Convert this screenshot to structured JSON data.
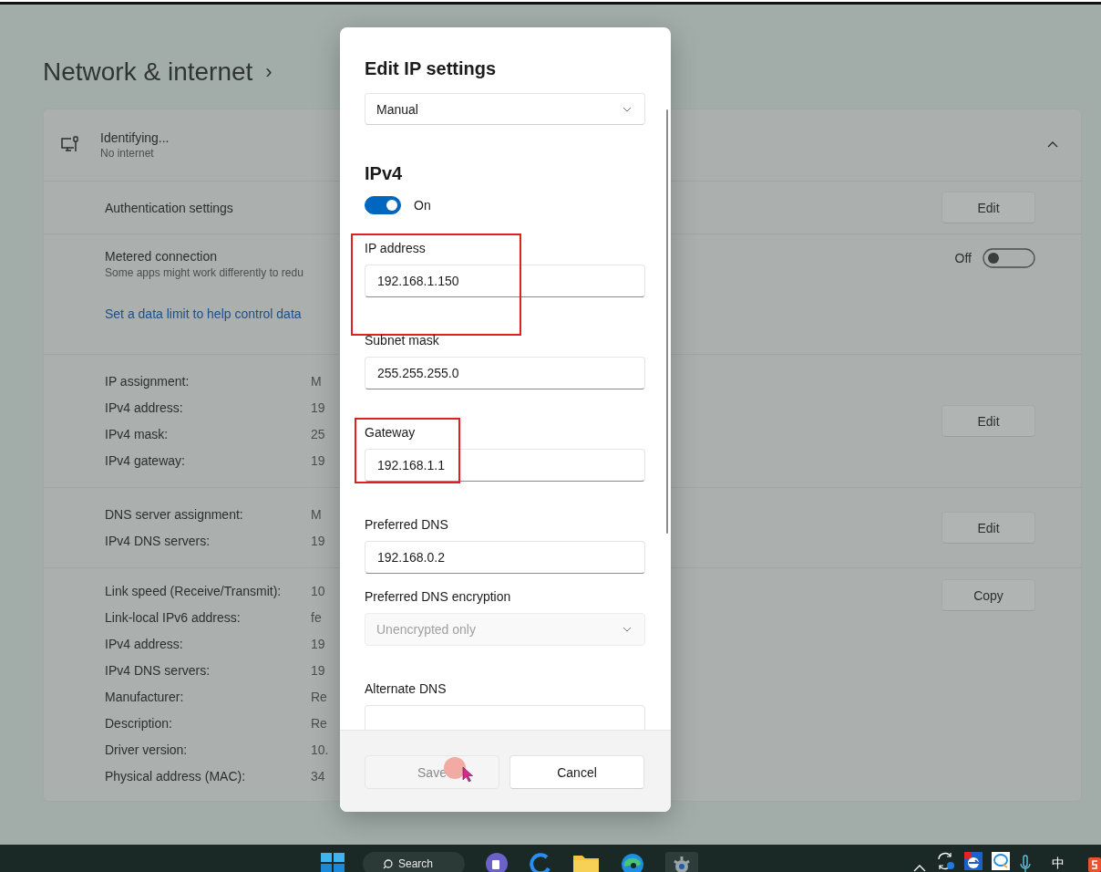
{
  "page": {
    "title": "Network & internet",
    "chevron": "›"
  },
  "connection": {
    "name": "Identifying...",
    "status": "No internet",
    "expanded": true
  },
  "settings_rows": [
    {
      "kind": "button",
      "label": "Authentication settings",
      "button": "Edit"
    },
    {
      "kind": "toggle",
      "label": "Metered connection",
      "description": "Some apps might work differently to redu",
      "link": "Set a data limit to help control data",
      "toggle_label": "Off",
      "on": false
    },
    {
      "kind": "properties",
      "button": "Edit",
      "properties": [
        {
          "label": "IP assignment:",
          "value": "M"
        },
        {
          "label": "IPv4 address:",
          "value": "19"
        },
        {
          "label": "IPv4 mask:",
          "value": "25"
        },
        {
          "label": "IPv4 gateway:",
          "value": "19"
        }
      ]
    },
    {
      "kind": "properties",
      "button": "Edit",
      "properties": [
        {
          "label": "DNS server assignment:",
          "value": "M"
        },
        {
          "label": "IPv4 DNS servers:",
          "value": "19"
        }
      ]
    },
    {
      "kind": "properties",
      "button": "Copy",
      "properties": [
        {
          "label": "Link speed (Receive/Transmit):",
          "value": "10"
        },
        {
          "label": "Link-local IPv6 address:",
          "value": "fe"
        },
        {
          "label": "IPv4 address:",
          "value": "19"
        },
        {
          "label": "IPv4 DNS servers:",
          "value": "19"
        },
        {
          "label": "Manufacturer:",
          "value": "Re"
        },
        {
          "label": "Description:",
          "value": "Re"
        },
        {
          "label": "Driver version:",
          "value": "10."
        },
        {
          "label": "Physical address (MAC):",
          "value": "34"
        }
      ]
    }
  ],
  "dialog": {
    "title": "Edit IP settings",
    "mode": "Manual",
    "section": "IPv4",
    "ipv4_on": true,
    "ipv4_label": "On",
    "fields": [
      {
        "kind": "text",
        "label": "IP address",
        "value": "192.168.1.150",
        "highlighted": true
      },
      {
        "kind": "text",
        "label": "Subnet mask",
        "value": "255.255.255.0",
        "highlighted": false
      },
      {
        "kind": "text",
        "label": "Gateway",
        "value": "192.168.1.1",
        "highlighted": true
      },
      {
        "kind": "text",
        "label": "Preferred DNS",
        "value": "192.168.0.2",
        "highlighted": false
      },
      {
        "kind": "dropdown",
        "label": "Preferred DNS encryption",
        "value": "Unencrypted only",
        "disabled": true,
        "highlighted": false
      },
      {
        "kind": "text",
        "label": "Alternate DNS",
        "highlighted": false
      }
    ],
    "buttons": [
      {
        "label": "Save",
        "disabled": true
      },
      {
        "label": "Cancel",
        "disabled": false
      }
    ]
  },
  "taskbar": {
    "search": "Search",
    "input_method": "中"
  }
}
